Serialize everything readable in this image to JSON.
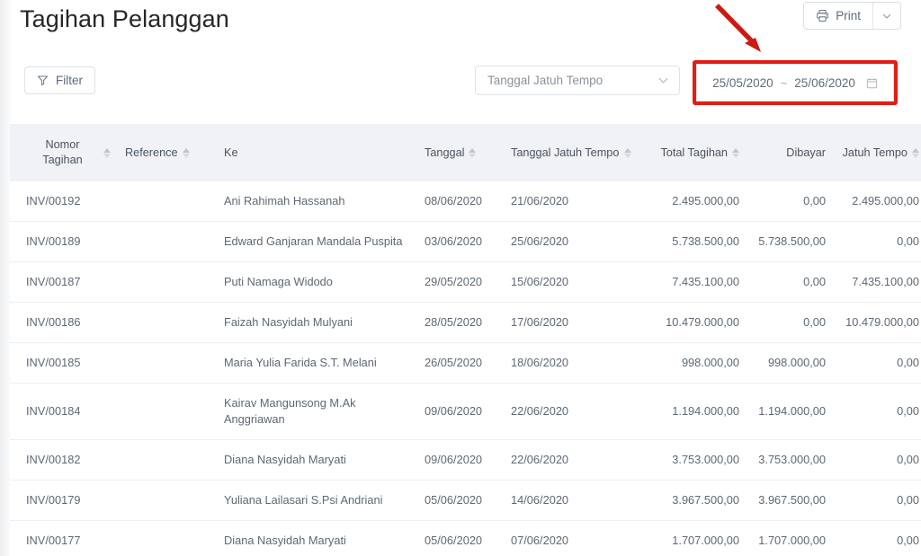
{
  "header": {
    "title": "Tagihan Pelanggan",
    "print_label": "Print",
    "print_icon": "printer-icon",
    "print_caret_icon": "chevron-down-icon"
  },
  "toolbar": {
    "filter_label": "Filter",
    "filter_icon": "funnel-icon",
    "date_field_select": {
      "value": "Tanggal Jatuh Tempo",
      "caret_icon": "chevron-down-icon"
    },
    "date_range": {
      "start": "25/05/2020",
      "separator": "~",
      "end": "25/06/2020",
      "calendar_icon": "calendar-icon"
    }
  },
  "annotation": {
    "highlight_color": "#e31d14",
    "arrow_color": "#cc1a12"
  },
  "table": {
    "columns": [
      {
        "label": "Nomor Tagihan",
        "sortable": true,
        "align": "left"
      },
      {
        "label": "Reference",
        "sortable": true,
        "align": "left"
      },
      {
        "label": "Ke",
        "sortable": false,
        "align": "left"
      },
      {
        "label": "Tanggal",
        "sortable": true,
        "align": "left"
      },
      {
        "label": "Tanggal Jatuh Tempo",
        "sortable": true,
        "align": "left"
      },
      {
        "label": "Total Tagihan",
        "sortable": true,
        "align": "right"
      },
      {
        "label": "Dibayar",
        "sortable": false,
        "align": "right"
      },
      {
        "label": "Jatuh Tempo",
        "sortable": true,
        "align": "right"
      }
    ],
    "rows": [
      {
        "nomor": "INV/00192",
        "reference": "",
        "ke": "Ani Rahimah Hassanah",
        "tanggal": "08/06/2020",
        "jatuh_tempo_tgl": "21/06/2020",
        "total": "2.495.000,00",
        "dibayar": "0,00",
        "jatuh_tempo": "2.495.000,00"
      },
      {
        "nomor": "INV/00189",
        "reference": "",
        "ke": "Edward Ganjaran Mandala Puspita",
        "tanggal": "03/06/2020",
        "jatuh_tempo_tgl": "25/06/2020",
        "total": "5.738.500,00",
        "dibayar": "5.738.500,00",
        "jatuh_tempo": "0,00"
      },
      {
        "nomor": "INV/00187",
        "reference": "",
        "ke": "Puti Namaga Widodo",
        "tanggal": "29/05/2020",
        "jatuh_tempo_tgl": "15/06/2020",
        "total": "7.435.100,00",
        "dibayar": "0,00",
        "jatuh_tempo": "7.435.100,00"
      },
      {
        "nomor": "INV/00186",
        "reference": "",
        "ke": "Faizah Nasyidah Mulyani",
        "tanggal": "28/05/2020",
        "jatuh_tempo_tgl": "17/06/2020",
        "total": "10.479.000,00",
        "dibayar": "0,00",
        "jatuh_tempo": "10.479.000,00"
      },
      {
        "nomor": "INV/00185",
        "reference": "",
        "ke": "Maria Yulia Farida S.T. Melani",
        "tanggal": "26/05/2020",
        "jatuh_tempo_tgl": "18/06/2020",
        "total": "998.000,00",
        "dibayar": "998.000,00",
        "jatuh_tempo": "0,00"
      },
      {
        "nomor": "INV/00184",
        "reference": "",
        "ke": "Kairav Mangunsong M.Ak Anggriawan",
        "tanggal": "09/06/2020",
        "jatuh_tempo_tgl": "22/06/2020",
        "total": "1.194.000,00",
        "dibayar": "1.194.000,00",
        "jatuh_tempo": "0,00"
      },
      {
        "nomor": "INV/00182",
        "reference": "",
        "ke": "Diana Nasyidah Maryati",
        "tanggal": "09/06/2020",
        "jatuh_tempo_tgl": "22/06/2020",
        "total": "3.753.000,00",
        "dibayar": "3.753.000,00",
        "jatuh_tempo": "0,00"
      },
      {
        "nomor": "INV/00179",
        "reference": "",
        "ke": "Yuliana Lailasari S.Psi Andriani",
        "tanggal": "05/06/2020",
        "jatuh_tempo_tgl": "14/06/2020",
        "total": "3.967.500,00",
        "dibayar": "3.967.500,00",
        "jatuh_tempo": "0,00"
      },
      {
        "nomor": "INV/00177",
        "reference": "",
        "ke": "Diana Nasyidah Maryati",
        "tanggal": "05/06/2020",
        "jatuh_tempo_tgl": "07/06/2020",
        "total": "1.707.000,00",
        "dibayar": "1.707.000,00",
        "jatuh_tempo": "0,00"
      }
    ]
  }
}
